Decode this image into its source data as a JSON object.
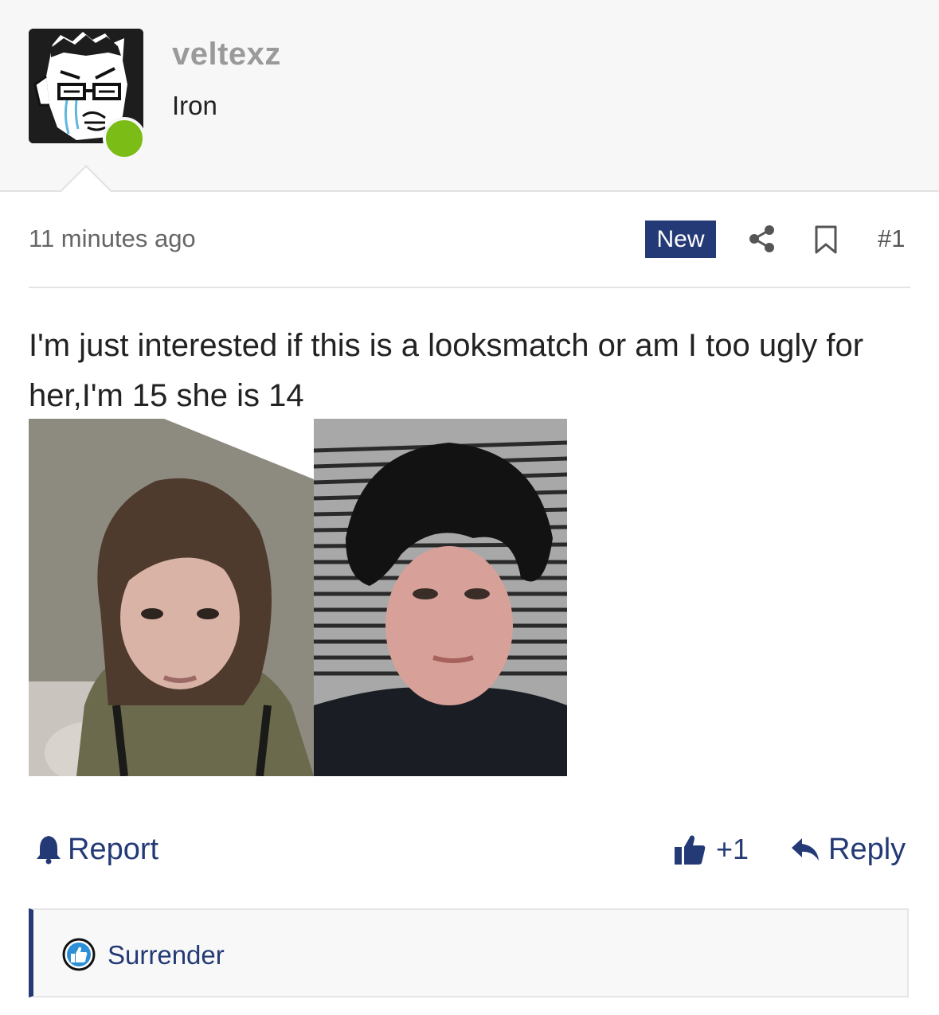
{
  "post_author": {
    "username": "veltexz",
    "rank": "Iron",
    "online_status_color": "#7cbc16",
    "avatar": "rage-comic-crying-face"
  },
  "post_meta": {
    "timestamp": "11 minutes ago",
    "badge": "New",
    "post_number": "#1",
    "share_icon": "share-icon",
    "bookmark_icon": "bookmark-icon"
  },
  "post_body": {
    "text": "I'm just interested if this is a looksmatch or am I too ugly for her,I'm 15 she is 14",
    "images": [
      "photo-girl",
      "photo-boy"
    ]
  },
  "actions": {
    "report_label": "Report",
    "like_count": "+1",
    "reply_label": "Reply"
  },
  "reactions": {
    "label": "Surrender"
  },
  "colors": {
    "accent": "#243a76",
    "online": "#7cbc16",
    "header_bg": "#f7f7f7"
  }
}
